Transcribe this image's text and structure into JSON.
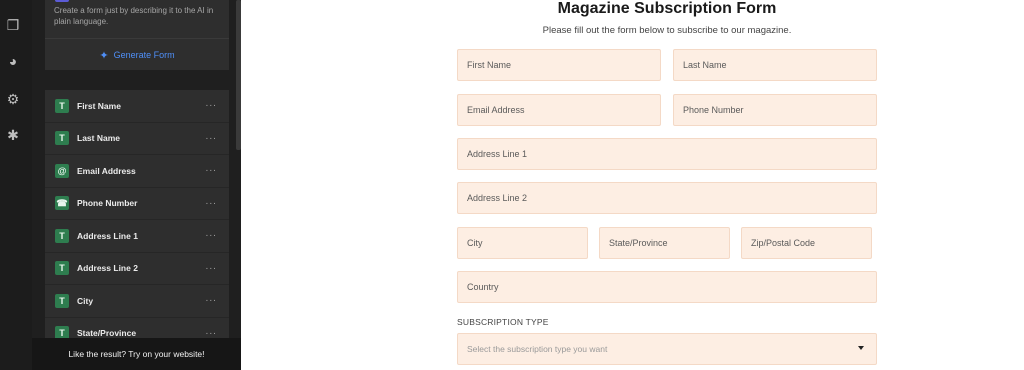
{
  "sidebar_rail": {
    "icons": [
      "copy-icon",
      "palette-icon",
      "gear-icon",
      "asterisk-icon"
    ]
  },
  "ai_card": {
    "description": "Create a form just by describing it to the AI in plain language.",
    "generate_label": "Generate Form"
  },
  "fields": [
    {
      "label": "First Name",
      "icon": "T"
    },
    {
      "label": "Last Name",
      "icon": "T"
    },
    {
      "label": "Email Address",
      "icon": "@"
    },
    {
      "label": "Phone Number",
      "icon": "☎"
    },
    {
      "label": "Address Line 1",
      "icon": "T"
    },
    {
      "label": "Address Line 2",
      "icon": "T"
    },
    {
      "label": "City",
      "icon": "T"
    },
    {
      "label": "State/Province",
      "icon": "T"
    }
  ],
  "more_glyph": "···",
  "promo_text": "Like the result? Try on your website!",
  "form": {
    "title": "Magazine Subscription Form",
    "subtitle": "Please fill out the form below to subscribe to our magazine.",
    "placeholders": {
      "first_name": "First Name",
      "last_name": "Last Name",
      "email": "Email Address",
      "phone": "Phone Number",
      "address1": "Address Line 1",
      "address2": "Address Line 2",
      "city": "City",
      "state": "State/Province",
      "zip": "Zip/Postal Code",
      "country": "Country"
    },
    "subscription_label": "SUBSCRIPTION TYPE",
    "subscription_placeholder": "Select the subscription type you want"
  },
  "colors": {
    "accent": "#4f8ff7",
    "field_icon_bg": "#2e7d4f",
    "input_bg": "#fdeee3"
  }
}
